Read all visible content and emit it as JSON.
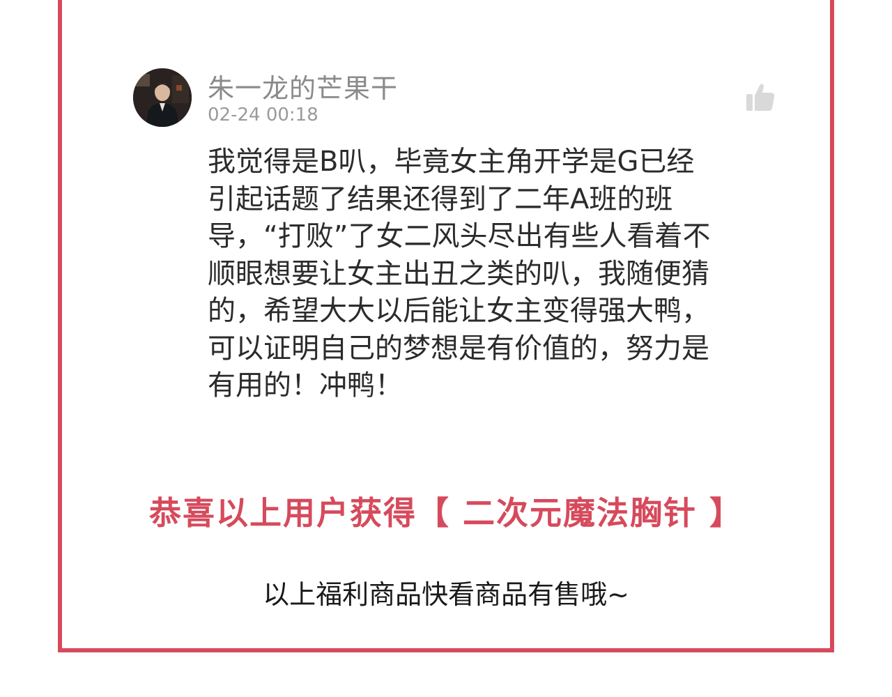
{
  "comment": {
    "username": "朱一龙的芒果干",
    "timestamp": "02-24 00:18",
    "text": "我觉得是B叭，毕竟女主角开学是G已经\n引起话题了结果还得到了二年A班的班\n导，“打败”了女二风头尽出有些人看着不\n顺眼想要让女主出丑之类的叭，我随便猜\n的，希望大大以后能让女主变得强大鸭，\n可以证明自己的梦想是有价值的，努力是\n有用的！冲鸭！",
    "like_icon": "thumbs-up-icon"
  },
  "announcement": "恭喜以上用户获得【 二次元魔法胸针 】",
  "footnote": "以上福利商品快看商品有售哦~",
  "colors": {
    "frame": "#d64a5c",
    "announcement": "#d64a5c",
    "username": "#8a8a8a",
    "timestamp": "#9a9a9a",
    "body_text": "#2b2b2b",
    "like_icon": "#d9d9d9"
  }
}
